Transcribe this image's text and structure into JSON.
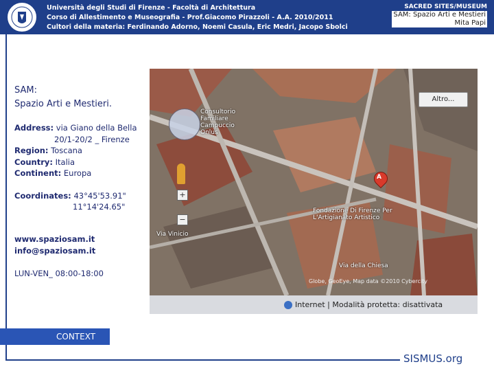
{
  "header": {
    "lines": [
      "Università degli Studi di Firenze - Facoltà di Architettura",
      "Corso di Allestimento e Museografia - Prof.Giacomo Pirazzoli - A.A. 2010/2011",
      "Cultori della materia: Ferdinando Adorno, Noemi Casula, Eric Medri, Jacopo Sbolci"
    ],
    "brand": "SACRED SITES/MUSEUM",
    "subtitle": "SAM: Spazio Arti e Mestieri",
    "author": "Mita Papi"
  },
  "info": {
    "title_line1": "SAM:",
    "title_line2": "Spazio Arti e Mestieri.",
    "address_label": "Address:",
    "address_line1": "via Giano della Bella",
    "address_line2": "20/1-20/2 _ Firenze",
    "region_label": "Region:",
    "region": "Toscana",
    "country_label": "Country:",
    "country": "Italia",
    "continent_label": "Continent:",
    "continent": "Europa",
    "coordinates_label": "Coordinates:",
    "coord_lat": "43°45'53.91\"",
    "coord_lon": "11°14'24.65\"",
    "website": "www.spaziosam.it",
    "email": "info@spaziosam.it",
    "hours": "LUN-VEN_ 08:00-18:00"
  },
  "map": {
    "altro_button": "Altro...",
    "label_consultorio": "Consultorio Familiare Campuccio Onlus",
    "label_fondazione": "Fondazione Di Firenze Per L'Artigianato Artistico",
    "label_street": "Via della Chiesa",
    "label_street2": "Via Vinicio",
    "copyright": "Globe, GeoEye, Map data ©2010 Cybercity",
    "marker_letter": "A",
    "status_text": "Internet | Modalità protetta: disattivata"
  },
  "nav": {
    "context_tab": "CONTEXT"
  },
  "footer": {
    "brand": "SISMUS.org"
  }
}
